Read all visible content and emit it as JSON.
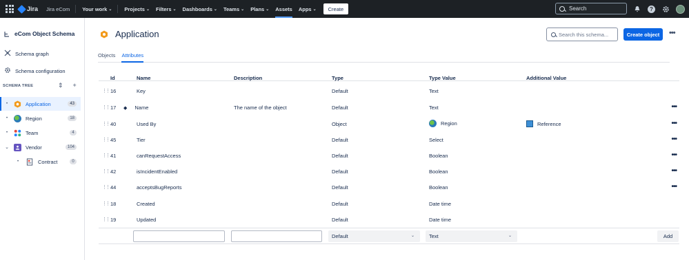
{
  "topnav": {
    "product": "Jira",
    "site": "Jira eCom",
    "items": [
      {
        "label": "Your work"
      },
      {
        "label": "Projects"
      },
      {
        "label": "Filters"
      },
      {
        "label": "Dashboards"
      },
      {
        "label": "Teams"
      },
      {
        "label": "Plans"
      },
      {
        "label": "Assets"
      },
      {
        "label": "Apps"
      }
    ],
    "create_label": "Create",
    "search_placeholder": "Search"
  },
  "sidebar": {
    "title": "eCom Object Schema",
    "links": [
      {
        "label": "Schema graph"
      },
      {
        "label": "Schema configuration"
      }
    ],
    "tree_heading": "SCHEMA TREE",
    "tree": [
      {
        "label": "Application",
        "count": "43"
      },
      {
        "label": "Region",
        "count": "18"
      },
      {
        "label": "Team",
        "count": "4"
      },
      {
        "label": "Vendor",
        "count": "104"
      },
      {
        "label": "Contract",
        "count": "0"
      }
    ]
  },
  "main": {
    "title": "Application",
    "search_placeholder": "Search this schema...",
    "create_object_label": "Create object",
    "tabs": [
      {
        "label": "Objects"
      },
      {
        "label": "Attributes"
      }
    ],
    "table": {
      "headers": {
        "id": "Id",
        "name": "Name",
        "description": "Description",
        "type": "Type",
        "type_value": "Type Value",
        "additional": "Additional Value"
      },
      "rows": [
        {
          "id": "16",
          "name": "Key",
          "description": "",
          "type": "Default",
          "type_value": "Text",
          "additional": ""
        },
        {
          "id": "17",
          "name": "Name",
          "description": "The name of the object",
          "type": "Default",
          "type_value": "Text",
          "additional": ""
        },
        {
          "id": "40",
          "name": "Used By",
          "description": "",
          "type": "Object",
          "type_value": "Region",
          "additional": "Reference"
        },
        {
          "id": "45",
          "name": "Tier",
          "description": "",
          "type": "Default",
          "type_value": "Select",
          "additional": ""
        },
        {
          "id": "41",
          "name": "canRequestAccess",
          "description": "",
          "type": "Default",
          "type_value": "Boolean",
          "additional": ""
        },
        {
          "id": "42",
          "name": "isIncidentEnabled",
          "description": "",
          "type": "Default",
          "type_value": "Boolean",
          "additional": ""
        },
        {
          "id": "44",
          "name": "acceptsBugReports",
          "description": "",
          "type": "Default",
          "type_value": "Boolean",
          "additional": ""
        },
        {
          "id": "18",
          "name": "Created",
          "description": "",
          "type": "Default",
          "type_value": "Date time",
          "additional": ""
        },
        {
          "id": "19",
          "name": "Updated",
          "description": "",
          "type": "Default",
          "type_value": "Date time",
          "additional": ""
        }
      ]
    },
    "add_row": {
      "type_select": "Default",
      "type_value_select": "Text",
      "add_label": "Add"
    }
  }
}
